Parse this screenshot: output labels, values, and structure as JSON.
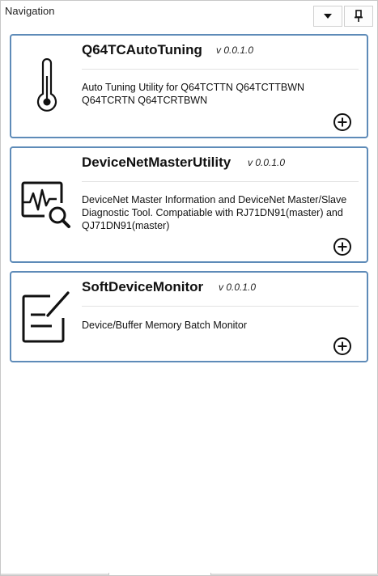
{
  "panel": {
    "title": "Navigation"
  },
  "header_buttons": {
    "dropdown_icon": "chevron-down-icon",
    "pin_icon": "pin-icon"
  },
  "colors": {
    "card_border": "#5e8bb8",
    "separator": "#e2e2e2"
  },
  "tools": [
    {
      "name": "Q64TCAutoTuning",
      "version": "v 0.0.1.0",
      "description": "Auto Tuning Utility for Q64TCTTN Q64TCTTBWN Q64TCRTN Q64TCRTBWN",
      "icon": "thermometer-icon"
    },
    {
      "name": "DeviceNetMasterUtility",
      "version": "v 0.0.1.0",
      "description": "DeviceNet Master Information and DeviceNet Master/Slave Diagnostic Tool. Compatiable with RJ71DN91(master) and QJ71DN91(master)",
      "icon": "monitor-search-icon"
    },
    {
      "name": "SoftDeviceMonitor",
      "version": "v 0.0.1.0",
      "description": "Device/Buffer Memory Batch Monitor",
      "icon": "edit-document-icon"
    }
  ]
}
